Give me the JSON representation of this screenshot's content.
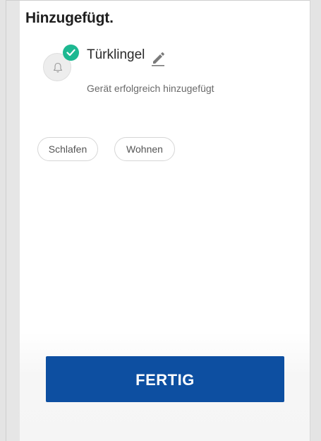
{
  "page": {
    "title": "Hinzugefügt."
  },
  "device": {
    "icon": "bell-icon",
    "status_icon": "check-circle-icon",
    "name": "Türklingel",
    "edit_icon": "pencil-icon",
    "status_text": "Gerät erfolgreich hinzugefügt"
  },
  "rooms": {
    "chips": [
      {
        "label": "Schlafen"
      },
      {
        "label": "Wohnen"
      }
    ]
  },
  "actions": {
    "done_label": "FERTIG"
  },
  "colors": {
    "primary": "#0d4fa1",
    "success": "#1db891",
    "background": "#ffffff",
    "frame": "#e6e6e6"
  }
}
